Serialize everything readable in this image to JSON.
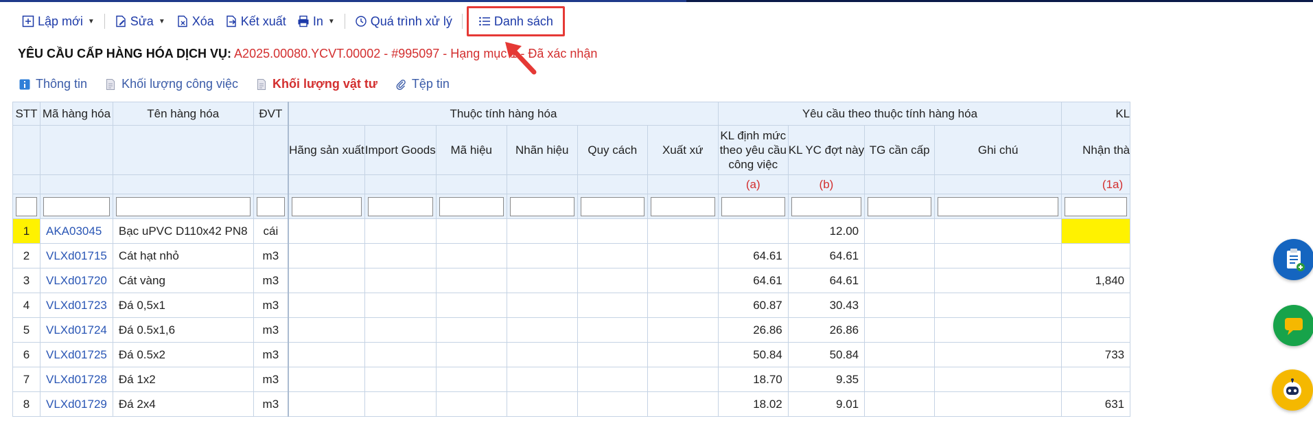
{
  "toolbar": {
    "new_label": "Lập mới",
    "edit_label": "Sửa",
    "delete_label": "Xóa",
    "export_label": "Kết xuất",
    "print_label": "In",
    "process_label": "Quá trình xử lý",
    "list_label": "Danh sách"
  },
  "title": {
    "label": "YÊU CẦU CẤP HÀNG HÓA DỊCH VỤ:",
    "value": "A2025.00080.YCVT.00002 - #995097 - Hạng mục 1 - Đã xác nhận"
  },
  "tabs": [
    {
      "label": "Thông tin",
      "icon": "info-icon"
    },
    {
      "label": "Khối lượng công việc",
      "icon": "document-icon"
    },
    {
      "label": "Khối lượng vật tư",
      "icon": "document-icon",
      "active": true
    },
    {
      "label": "Tệp tin",
      "icon": "paperclip-icon"
    }
  ],
  "table": {
    "headers": {
      "stt": "STT",
      "code": "Mã hàng hóa",
      "name": "Tên hàng hóa",
      "unit": "ĐVT",
      "group_attr": "Thuộc tính hàng hóa",
      "group_req": "Yêu cầu theo thuộc tính hàng hóa",
      "group_kl": "KL",
      "manufacturer": "Hãng sản xuất",
      "import_goods": "Import Goods",
      "model": "Mã hiệu",
      "brand": "Nhãn hiệu",
      "spec": "Quy cách",
      "origin": "Xuất xứ",
      "kl_norm": "KL định mức theo yêu cầu công việc",
      "kl_req": "KL YC đợt này",
      "tg": "TG cần cấp",
      "note": "Ghi chú",
      "received": "Nhận thà",
      "mark_a": "(a)",
      "mark_b": "(b)",
      "mark_1a": "(1a)"
    },
    "rows": [
      {
        "stt": "1",
        "code": "AKA03045",
        "name": "Bạc uPVC D110x42 PN8",
        "unit": "cái",
        "kl_norm": "",
        "kl_req": "12.00",
        "received": ""
      },
      {
        "stt": "2",
        "code": "VLXd01715",
        "name": "Cát hạt nhỏ",
        "unit": "m3",
        "kl_norm": "64.61",
        "kl_req": "64.61",
        "received": ""
      },
      {
        "stt": "3",
        "code": "VLXd01720",
        "name": "Cát vàng",
        "unit": "m3",
        "kl_norm": "64.61",
        "kl_req": "64.61",
        "received": "1,840"
      },
      {
        "stt": "4",
        "code": "VLXd01723",
        "name": "Đá 0,5x1",
        "unit": "m3",
        "kl_norm": "60.87",
        "kl_req": "30.43",
        "received": ""
      },
      {
        "stt": "5",
        "code": "VLXd01724",
        "name": "Đá 0.5x1,6",
        "unit": "m3",
        "kl_norm": "26.86",
        "kl_req": "26.86",
        "received": ""
      },
      {
        "stt": "6",
        "code": "VLXd01725",
        "name": "Đá 0.5x2",
        "unit": "m3",
        "kl_norm": "50.84",
        "kl_req": "50.84",
        "received": "733"
      },
      {
        "stt": "7",
        "code": "VLXd01728",
        "name": "Đá 1x2",
        "unit": "m3",
        "kl_norm": "18.70",
        "kl_req": "9.35",
        "received": ""
      },
      {
        "stt": "8",
        "code": "VLXd01729",
        "name": "Đá 2x4",
        "unit": "m3",
        "kl_norm": "18.02",
        "kl_req": "9.01",
        "received": "631"
      }
    ]
  },
  "colors": {
    "accent": "#1d3aa8",
    "link": "#2a56b5",
    "highlight_red": "#d32f2f",
    "selected_yellow": "#fff200",
    "header_bg": "#e8f1fb"
  }
}
